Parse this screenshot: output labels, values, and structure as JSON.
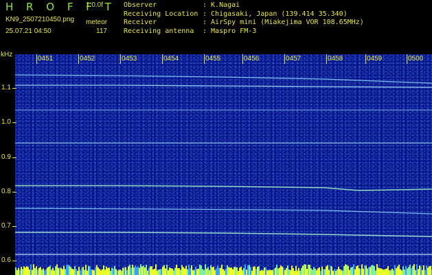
{
  "header": {
    "title": "H R O F F T",
    "version": "1.0.0f",
    "filename": "KN9_2507210450.png",
    "meteor_label": "meteor",
    "datetime": "25.07.21 04:50",
    "meteor_count": "117"
  },
  "info": [
    {
      "key": "Observer",
      "value": ": K.Nagai"
    },
    {
      "key": "Receiving Location",
      "value": ": Chigasaki, Japan (139.414 35.340)"
    },
    {
      "key": "Receiver",
      "value": ": AirSpy mini (Miakejima VOR 108.65MHz)"
    },
    {
      "key": "Receiving antenna",
      "value": ": Maspro FM-3"
    }
  ],
  "spectrogram": {
    "freq_unit": "kHz",
    "freq_ticks": [
      "1.1",
      "1.0",
      "0.9",
      "0.8",
      "0.7",
      "0.6"
    ],
    "time_ticks": [
      "0451",
      "0452",
      "0453",
      "0454",
      "0455",
      "0456",
      "0457",
      "0458",
      "0459",
      "0500"
    ],
    "background_color": "#06158c",
    "trace_color": "#8fd8ff"
  }
}
